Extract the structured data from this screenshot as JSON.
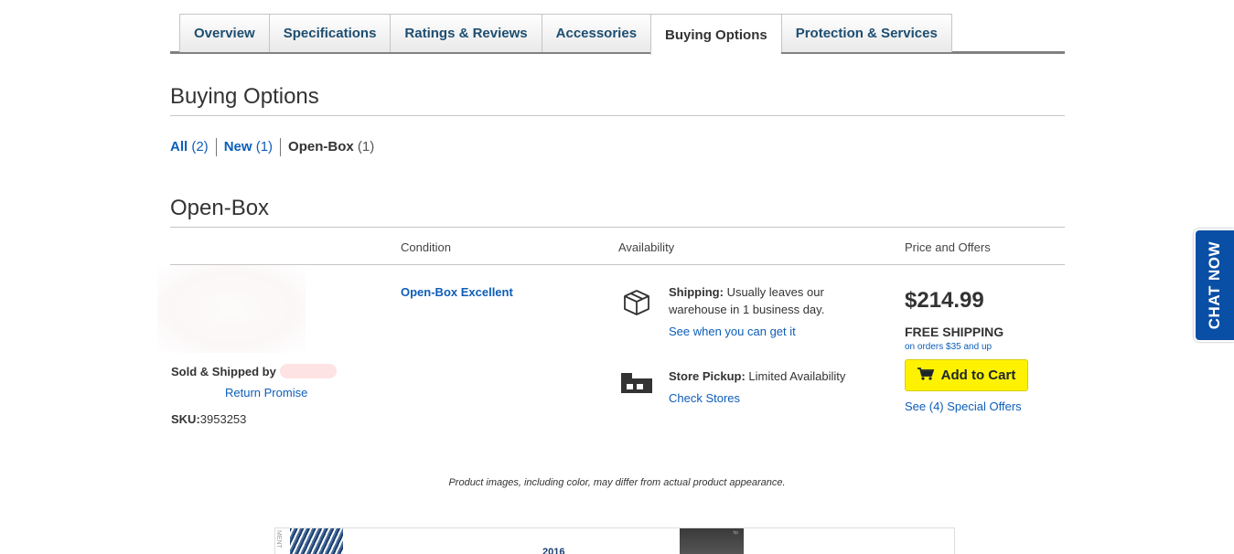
{
  "tabs": [
    {
      "label": "Overview"
    },
    {
      "label": "Specifications"
    },
    {
      "label": "Ratings & Reviews"
    },
    {
      "label": "Accessories"
    },
    {
      "label": "Buying Options"
    },
    {
      "label": "Protection & Services"
    }
  ],
  "buying_options": {
    "title": "Buying Options",
    "filters": [
      {
        "label": "All",
        "count": "(2)"
      },
      {
        "label": "New",
        "count": "(1)"
      },
      {
        "label": "Open-Box",
        "count": "(1)"
      }
    ]
  },
  "open_box": {
    "title": "Open-Box",
    "columns": {
      "condition": "Condition",
      "availability": "Availability",
      "price": "Price and Offers"
    },
    "listing": {
      "sold_by_label": "Sold & Shipped by",
      "return_link": "Return Promise",
      "sku_label": "SKU:",
      "sku_value": "3953253",
      "condition": "Open-Box Excellent",
      "shipping_label": "Shipping:",
      "shipping_text_1": "Usually leaves our",
      "shipping_text_2": "warehouse in 1 business day.",
      "shipping_link": "See when you can get it",
      "pickup_label": "Store Pickup:",
      "pickup_text": "Limited Availability",
      "pickup_link": "Check Stores",
      "price": "$214.99",
      "free_shipping": "FREE SHIPPING",
      "shipping_note": "on orders $35 and up",
      "add_to_cart": "Add to Cart",
      "offers_link": "See (4) Special Offers"
    }
  },
  "disclaimer": "Product images, including color, may differ from actual product appearance.",
  "banner": {
    "year": "2016",
    "side_text": "MENT",
    "device_label": "hp"
  },
  "chat": {
    "label": "CHAT NOW"
  },
  "colors": {
    "link": "#0d5eb8",
    "cart_button": "#fff200",
    "chat": "#0a4fa6"
  }
}
